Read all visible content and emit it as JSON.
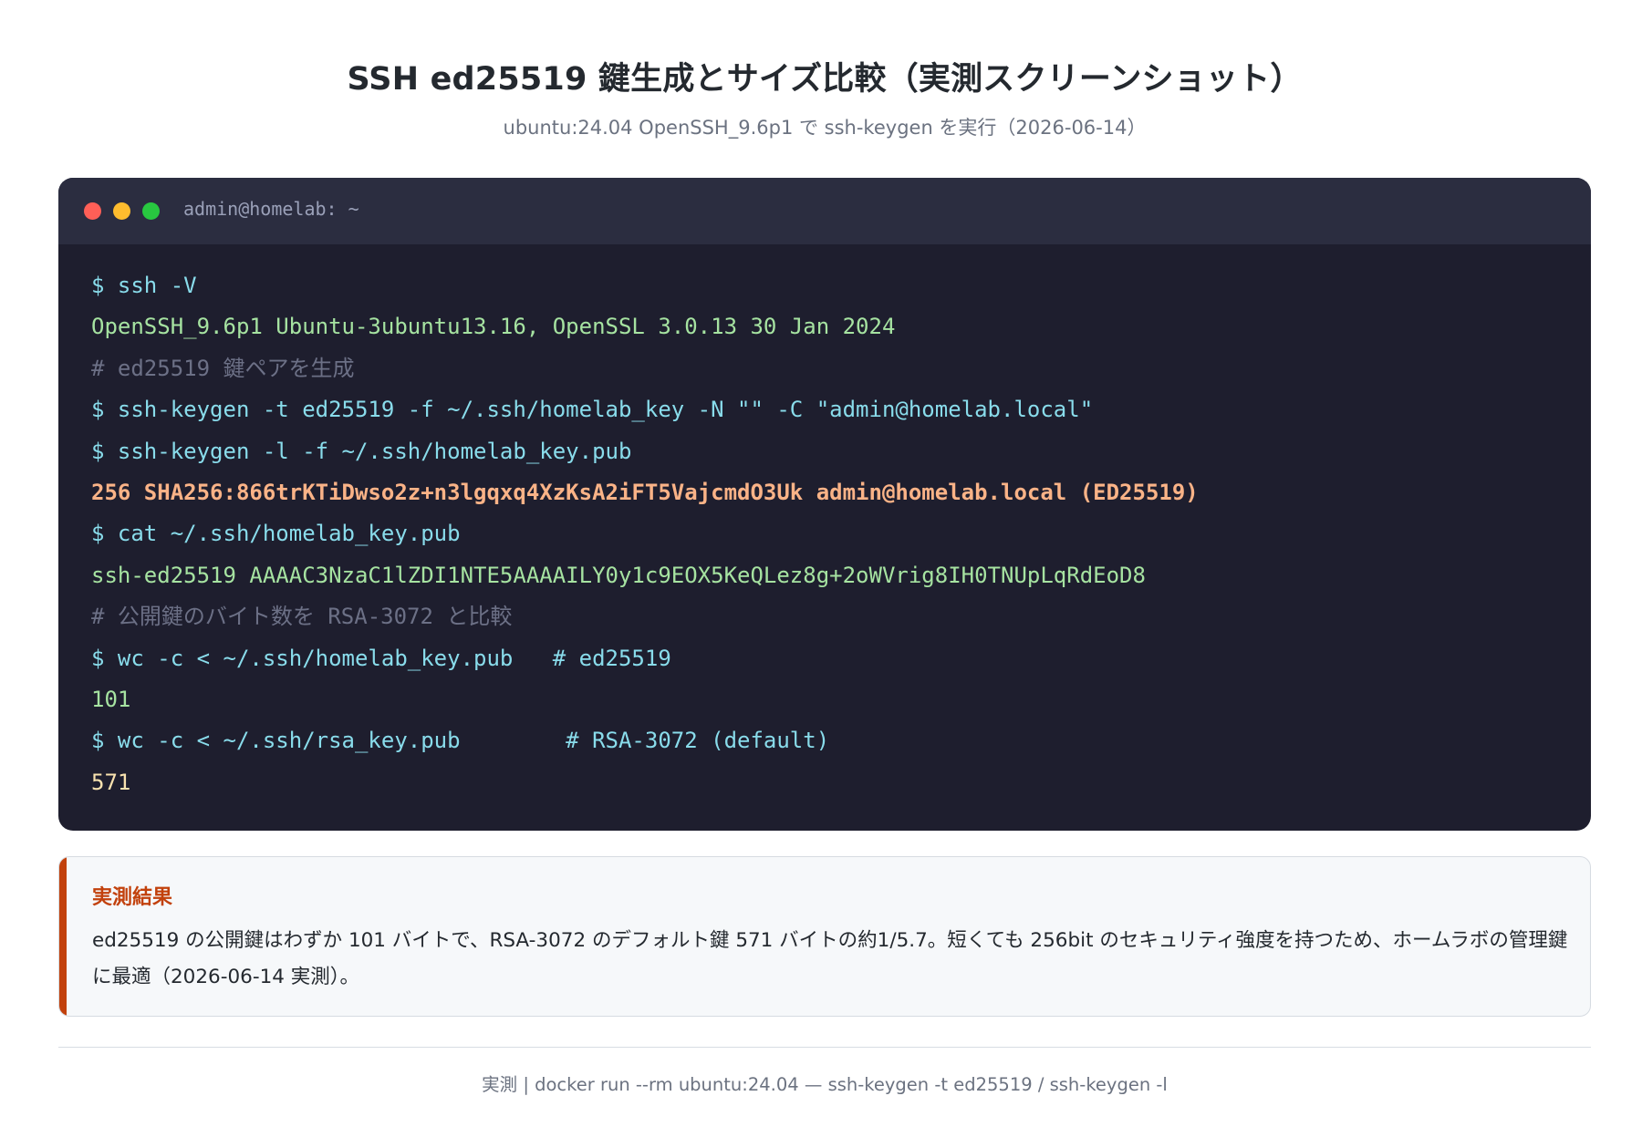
{
  "page": {
    "title": "SSH ed25519 鍵生成とサイズ比較（実測スクリーンショット）",
    "subtitle": "ubuntu:24.04 OpenSSH_9.6p1 で ssh-keygen を実行（2026-06-14）"
  },
  "terminal": {
    "window_title": "admin@homelab: ~",
    "controls": [
      "close",
      "minimize",
      "maximize"
    ],
    "lines": [
      {
        "text": "$ ssh -V",
        "style": "cmd"
      },
      {
        "text": "OpenSSH_9.6p1 Ubuntu-3ubuntu13.16, OpenSSL 3.0.13 30 Jan 2024",
        "style": "out"
      },
      {
        "text": "# ed25519 鍵ペアを生成",
        "style": "comment"
      },
      {
        "text": "$ ssh-keygen -t ed25519 -f ~/.ssh/homelab_key -N \"\" -C \"admin@homelab.local\"",
        "style": "cmd"
      },
      {
        "text": "$ ssh-keygen -l -f ~/.ssh/homelab_key.pub",
        "style": "cmd"
      },
      {
        "text": "256 SHA256:866trKTiDwso2z+n3lgqxq4XzKsA2iFT5VajcmdO3Uk admin@homelab.local (ED25519)",
        "style": "highlight"
      },
      {
        "text": "$ cat ~/.ssh/homelab_key.pub",
        "style": "cmd"
      },
      {
        "text": "ssh-ed25519 AAAAC3NzaC1lZDI1NTE5AAAAILY0y1c9EOX5KeQLez8g+2oWVrig8IH0TNUpLqRdEoD8",
        "style": "out"
      },
      {
        "text": "# 公開鍵のバイト数を RSA-3072 と比較",
        "style": "comment"
      },
      {
        "text": "$ wc -c < ~/.ssh/homelab_key.pub   # ed25519",
        "style": "cmd"
      },
      {
        "text": "101",
        "style": "out"
      },
      {
        "text": "$ wc -c < ~/.ssh/rsa_key.pub        # RSA-3072 (default)",
        "style": "cmd"
      },
      {
        "text": "571",
        "style": "num"
      }
    ]
  },
  "callout": {
    "heading": "実測結果",
    "text": "ed25519 の公開鍵はわずか 101 バイトで、RSA-3072 のデフォルト鍵 571 バイトの約1/5.7。短くても 256bit のセキュリティ強度を持つため、ホームラボの管理鍵に最適（2026-06-14 実測）。",
    "accent_color": "#c2410c"
  },
  "footer": {
    "text": "実測 | docker run --rm ubuntu:24.04 — ssh-keygen -t ed25519 / ssh-keygen -l"
  },
  "colors": {
    "terminal_bg": "#1e1e2e",
    "titlebar_bg": "#2b2d40",
    "command": "#89dceb",
    "output": "#a6e3a1",
    "comment": "#6c7086",
    "highlight": "#fab387",
    "number": "#f9e2af"
  }
}
